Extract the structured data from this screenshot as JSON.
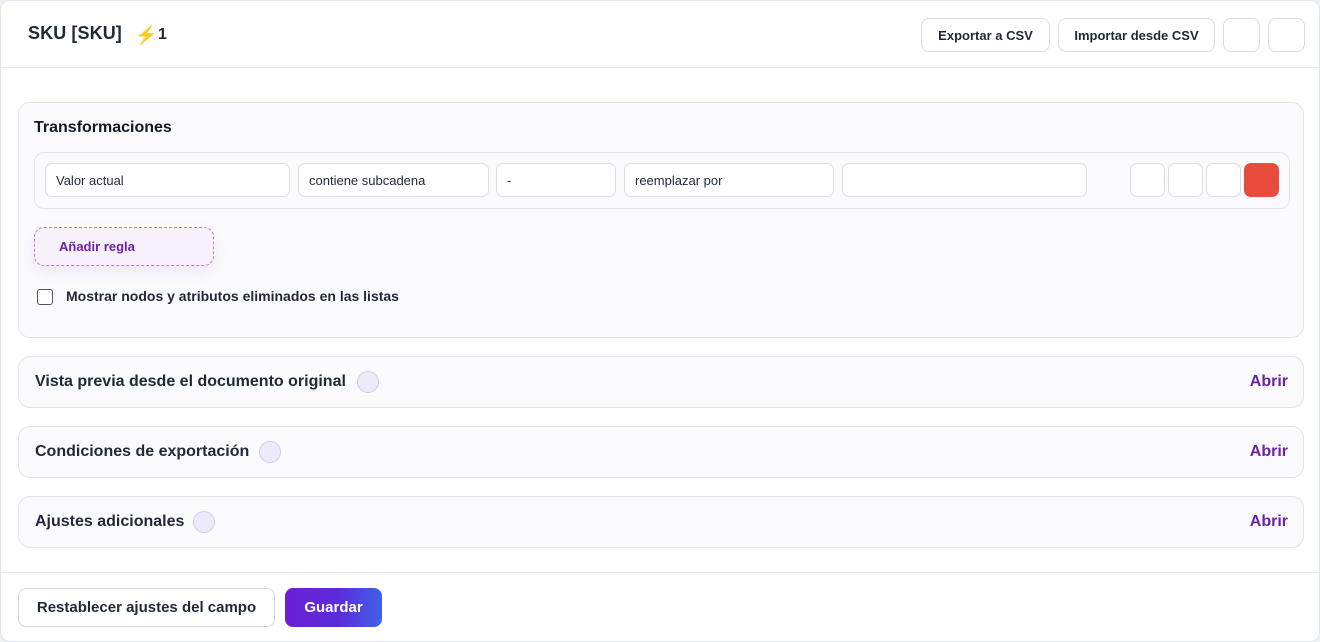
{
  "header": {
    "title": "SKU [SKU]",
    "bolt_icon": "lightning-icon",
    "count": "1",
    "export_label": "Exportar a CSV",
    "import_label": "Importar desde CSV"
  },
  "transformations": {
    "title": "Transformaciones",
    "rule": {
      "source": "Valor actual",
      "condition": "contiene subcadena",
      "match_value": "-",
      "action": "reemplazar por",
      "replacement": ""
    },
    "add_rule_label": "Añadir regla",
    "show_deleted_label": "Mostrar nodos y atributos eliminados en las listas",
    "show_deleted_checked": false
  },
  "sections": [
    {
      "title": "Vista previa desde el documento original",
      "open_label": "Abrir"
    },
    {
      "title": "Condiciones de exportación",
      "open_label": "Abrir"
    },
    {
      "title": "Ajustes adicionales",
      "open_label": "Abrir"
    }
  ],
  "footer": {
    "reset_label": "Restablecer ajustes del campo",
    "save_label": "Guardar"
  },
  "colors": {
    "accent": "#6b21a8",
    "delete": "#e74c3c",
    "bolt": "#f5b400"
  }
}
